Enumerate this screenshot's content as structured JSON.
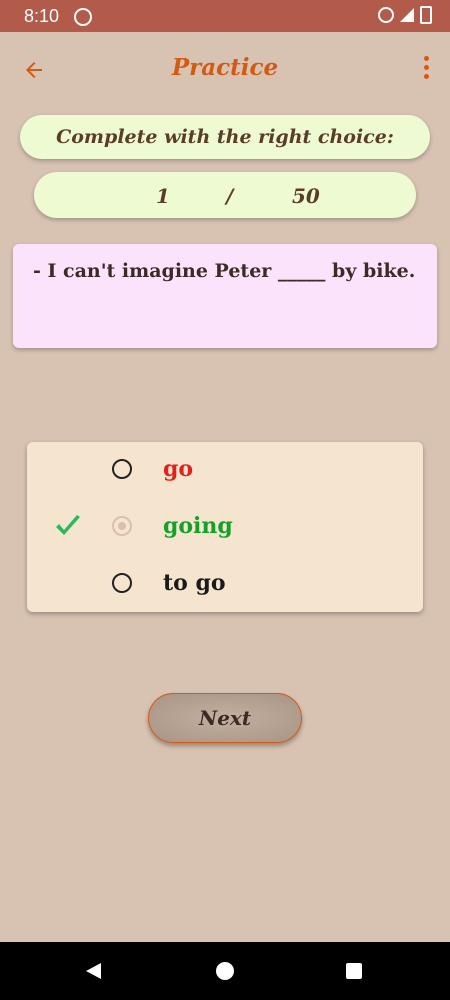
{
  "status_bar": {
    "time": "8:10"
  },
  "app_bar": {
    "title": "Practice",
    "back_icon": "arrow-left",
    "menu_icon": "more-vertical"
  },
  "instruction": "Complete with the right choice:",
  "counter": {
    "current": "1",
    "separator": "/",
    "total": "50"
  },
  "question": "- I can't imagine Peter _____ by bike.",
  "options": [
    {
      "label": "go",
      "state": "wrong",
      "color": "#e3201b"
    },
    {
      "label": "going",
      "state": "correct",
      "color": "#14a12a"
    },
    {
      "label": "to go",
      "state": "normal",
      "color": "#1a1a1a"
    }
  ],
  "next_button": {
    "label": "Next"
  },
  "colors": {
    "accent": "#d35a12",
    "status_bar": "#b25b4a",
    "background": "#d8c2b2"
  }
}
